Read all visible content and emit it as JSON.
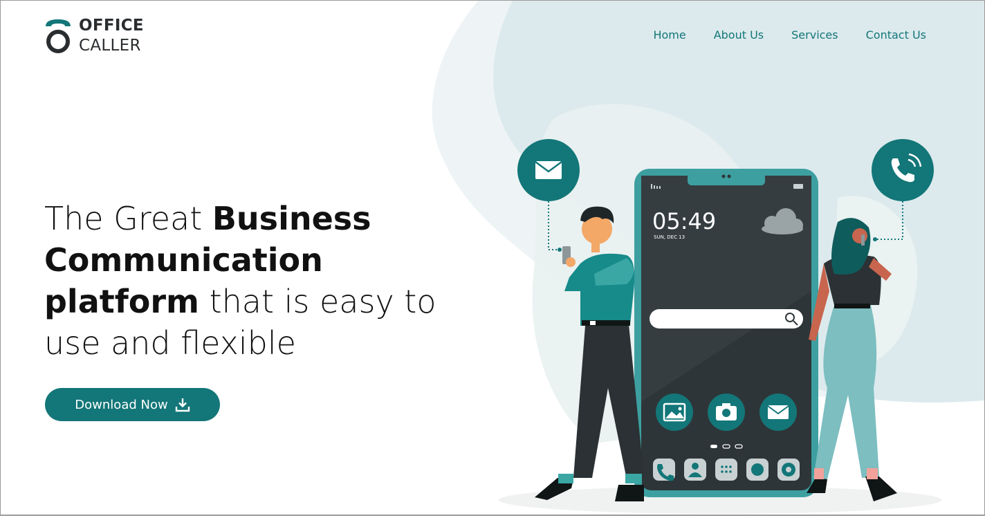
{
  "brand": {
    "line1": "OFFICE",
    "line2": "CALLER",
    "accent": "#137678"
  },
  "nav": {
    "items": [
      {
        "label": "Home"
      },
      {
        "label": "About Us"
      },
      {
        "label": "Services"
      },
      {
        "label": "Contact Us"
      }
    ]
  },
  "hero": {
    "part1": "The Great ",
    "bold1": "Business Communication platform",
    "part2": " that is easy to use and flexible",
    "cta_label": "Download Now",
    "cta_icon": "download-icon"
  },
  "phone": {
    "time": "05:49",
    "date": "SUN, DEC 13",
    "app_icons": [
      "image-icon",
      "camera-icon",
      "mail-icon"
    ],
    "dock_icons": [
      "phone-icon",
      "contact-icon",
      "apps-icon",
      "chat-icon",
      "settings-icon"
    ]
  },
  "colors": {
    "teal": "#137678",
    "dark": "#2b3134",
    "bg_light": "#e8f1f2"
  }
}
